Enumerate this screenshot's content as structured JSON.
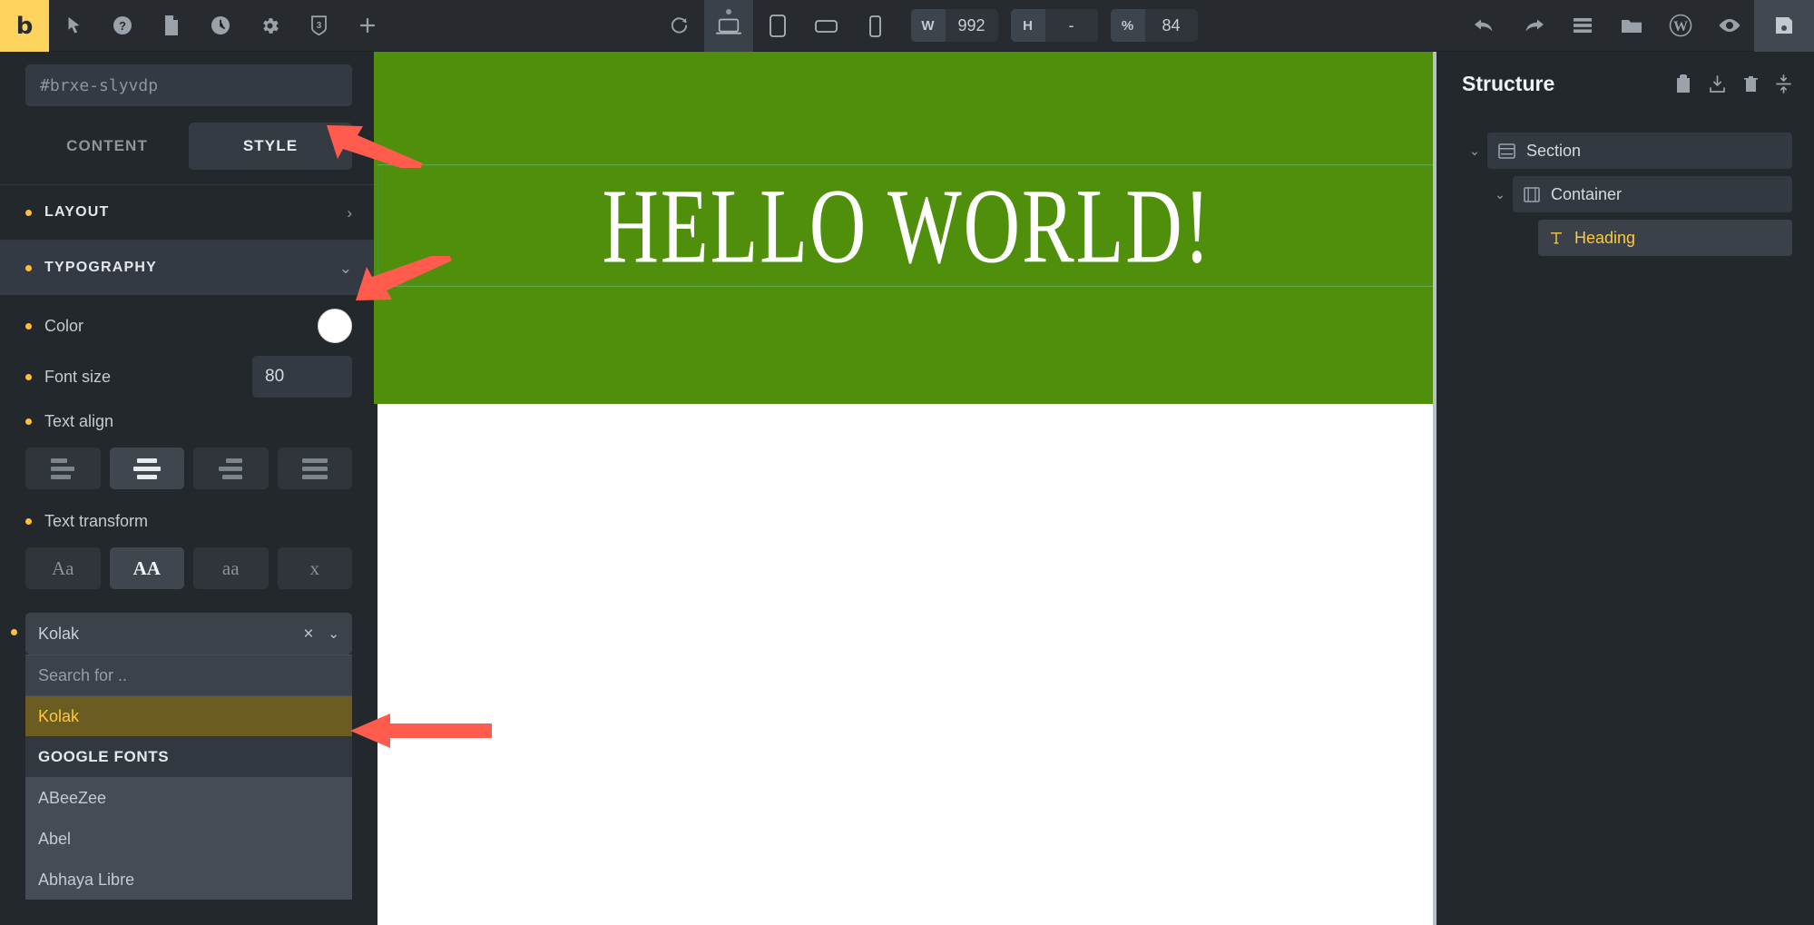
{
  "toolbar": {
    "logo": "b",
    "left_icons": [
      {
        "name": "cursor-icon",
        "label": "Select"
      },
      {
        "name": "help-icon",
        "label": "Help"
      },
      {
        "name": "page-icon",
        "label": "Page"
      },
      {
        "name": "history-icon",
        "label": "Revisions"
      },
      {
        "name": "settings-icon",
        "label": "Settings"
      },
      {
        "name": "css-icon",
        "label": "Custom CSS"
      },
      {
        "name": "plus-icon",
        "label": "Add element"
      }
    ],
    "refresh_label": "Refresh",
    "devices": [
      {
        "name": "desktop-icon",
        "label": "Desktop",
        "active": true
      },
      {
        "name": "tablet-portrait-icon",
        "label": "Tablet portrait",
        "active": false
      },
      {
        "name": "tablet-landscape-icon",
        "label": "Tablet landscape",
        "active": false
      },
      {
        "name": "mobile-icon",
        "label": "Mobile",
        "active": false
      }
    ],
    "width": {
      "label": "W",
      "value": "992"
    },
    "height": {
      "label": "H",
      "value": "-"
    },
    "zoom": {
      "label": "%",
      "value": "84"
    },
    "right_icons": [
      {
        "name": "undo-icon",
        "label": "Undo"
      },
      {
        "name": "redo-icon",
        "label": "Redo"
      },
      {
        "name": "list-icon",
        "label": "Structure"
      },
      {
        "name": "folder-icon",
        "label": "Templates"
      },
      {
        "name": "wordpress-icon",
        "label": "WordPress"
      },
      {
        "name": "eye-icon",
        "label": "Preview"
      }
    ],
    "save": {
      "name": "save-icon",
      "label": "Save"
    }
  },
  "left_panel": {
    "id_field": {
      "placeholder": "#brxe-slyvdp",
      "value": ""
    },
    "tabs": [
      {
        "label": "CONTENT",
        "active": false
      },
      {
        "label": "STYLE",
        "active": true
      }
    ],
    "sections": [
      {
        "label": "LAYOUT",
        "expanded": false
      },
      {
        "label": "TYPOGRAPHY",
        "expanded": true
      }
    ],
    "typography": {
      "color_label": "Color",
      "color_value": "#ffffff",
      "font_size_label": "Font size",
      "font_size_value": "80",
      "text_align_label": "Text align",
      "text_align_options": [
        {
          "name": "align-left",
          "active": false
        },
        {
          "name": "align-center",
          "active": true
        },
        {
          "name": "align-right",
          "active": false
        },
        {
          "name": "align-justify",
          "active": false
        }
      ],
      "text_transform_label": "Text transform",
      "text_transform_options": [
        {
          "label": "Aa",
          "name": "capitalize",
          "active": false
        },
        {
          "label": "AA",
          "name": "uppercase",
          "active": true
        },
        {
          "label": "aa",
          "name": "lowercase",
          "active": false
        },
        {
          "label": "x",
          "name": "none",
          "active": false
        }
      ],
      "font_family": {
        "value": "Kolak",
        "clear_icon": "×",
        "chevron_icon": "⌄",
        "search_placeholder": "Search for ..",
        "selected_option": "Kolak",
        "group_label": "GOOGLE FONTS",
        "options": [
          "ABeeZee",
          "Abel",
          "Abhaya Libre"
        ]
      }
    }
  },
  "canvas": {
    "heading": "Hello World!",
    "background_color": "#4f8f0c",
    "heading_color": "#ffffff"
  },
  "right_panel": {
    "title": "Structure",
    "actions": [
      {
        "name": "paste-icon",
        "label": "Paste"
      },
      {
        "name": "download-icon",
        "label": "Import"
      },
      {
        "name": "trash-icon",
        "label": "Delete"
      },
      {
        "name": "collapse-icon",
        "label": "Collapse all"
      }
    ],
    "tree": [
      {
        "label": "Section",
        "icon": "section-icon",
        "depth": 0,
        "active": false,
        "expandable": true
      },
      {
        "label": "Container",
        "icon": "container-icon",
        "depth": 1,
        "active": false,
        "expandable": true
      },
      {
        "label": "Heading",
        "icon": "text-icon",
        "depth": 2,
        "active": true,
        "expandable": false
      }
    ]
  },
  "annotations": {
    "color": "#ff5c4d",
    "arrows": [
      {
        "target": "style-tab"
      },
      {
        "target": "typography-section"
      },
      {
        "target": "kolak-option"
      }
    ]
  }
}
